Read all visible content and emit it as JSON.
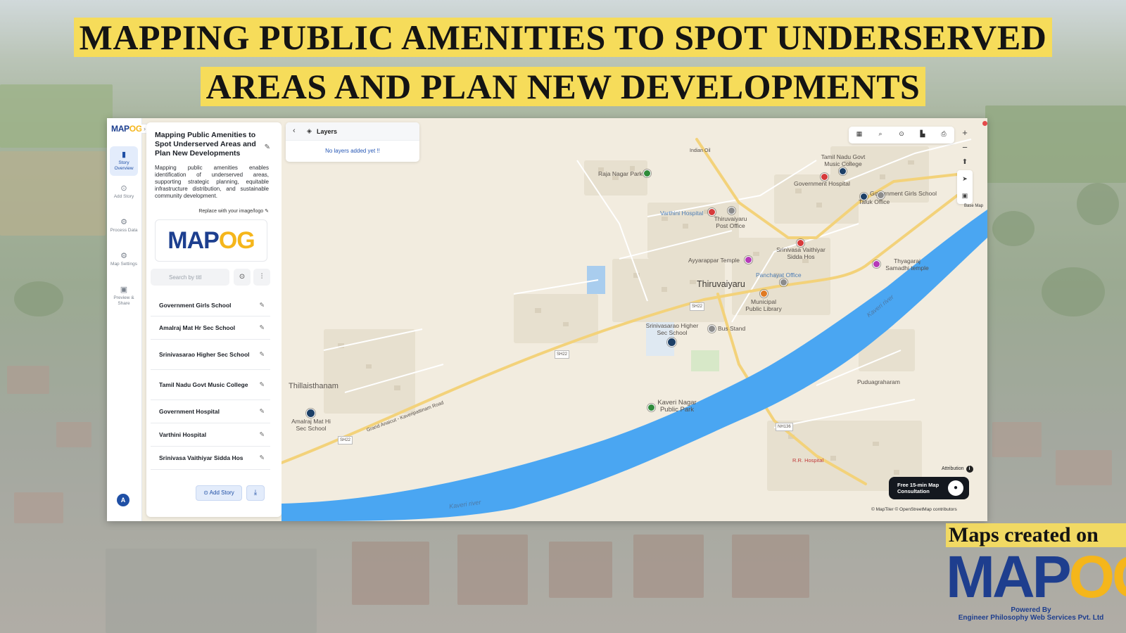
{
  "headline": {
    "line1": "MAPPING PUBLIC AMENITIES TO SPOT UNDERSERVED",
    "line2": "AREAS AND PLAN NEW DEVELOPMENTS"
  },
  "rail": {
    "logo": "MAP",
    "logo_accent": "OG",
    "items": [
      {
        "label": "Story Overview",
        "icon": "book-icon",
        "active": true
      },
      {
        "label": "Add Story",
        "icon": "map-pin-icon",
        "active": false
      },
      {
        "label": "Process Data",
        "icon": "gear-icon",
        "active": false
      },
      {
        "label": "Map Settings",
        "icon": "settings-icon",
        "active": false
      },
      {
        "label": "Preview & Share",
        "icon": "share-icon",
        "active": false
      }
    ],
    "avatar": "A"
  },
  "panel": {
    "title": "Mapping Public Amenities to Spot Underserved Areas and Plan New Developments",
    "description": "Mapping public amenities enables identification of underserved areas, supporting strategic planning, equitable infrastructure distribution, and sustainable community development.",
    "replace_label": "Replace with your image/logo",
    "logo": "MAP",
    "logo_accent": "OG",
    "search_placeholder": "Search by titl",
    "stories": [
      "Government Girls School",
      "Amalraj Mat Hr Sec School",
      "Srinivasarao Higher Sec School",
      "Tamil Nadu Govt Music College",
      "Government Hospital",
      "Varthini Hospital",
      "Srinivasa Vaithiyar Sidda Hos"
    ],
    "add_story_label": "Add Story"
  },
  "layers": {
    "title": "Layers",
    "empty_text": "No layers added yet !!"
  },
  "map": {
    "places": {
      "thiruvaiyaru": "Thiruvaiyaru",
      "thillaisthanam": "Thillaisthanam",
      "puduagraharam": "Puduagraharam",
      "river1": "Kaveri river",
      "river2": "Kaveri river",
      "road": "Grand Anaicut - Kaveripattinam Road",
      "indian_oil": "Indian Oil",
      "rr_hospital": "R.R. Hospital",
      "sh22a": "SH22",
      "sh22b": "SH22",
      "sh22c": "SH22",
      "nh136": "NH136"
    },
    "pois": [
      {
        "label": "Raja Nagar Park",
        "color": "#2e8b3a"
      },
      {
        "label": "Tamil Nadu Govt Music College",
        "color": "#d63a3a"
      },
      {
        "label": "Government Hospital",
        "color": "#d63a3a"
      },
      {
        "label": "Government Girls School",
        "color": "#1c3f66"
      },
      {
        "label": "Taluk Office",
        "color": "#8c8c8c"
      },
      {
        "label": "Varthini Hospital",
        "color": "#d63a3a"
      },
      {
        "label": "Thiruvaiyaru Post Office",
        "color": "#8c8c8c"
      },
      {
        "label": "Srinivasa Vaithiyar Sidda Hos",
        "color": "#d63a3a"
      },
      {
        "label": "Ayyarappar Temple",
        "color": "#b53ab8"
      },
      {
        "label": "Thyagaraj Samadhi temple",
        "color": "#b53ab8"
      },
      {
        "label": "Panchayat Office",
        "color": "#8c8c8c"
      },
      {
        "label": "Municipal Public Library",
        "color": "#e07a22"
      },
      {
        "label": "Bus Stand",
        "color": "#8c8c8c"
      },
      {
        "label": "Srinivasarao Higher Sec School",
        "color": "#1c3f66"
      },
      {
        "label": "Kaveri Nagar Public Park",
        "color": "#2e8b3a"
      },
      {
        "label": "Amalraj Mat Hi Sec School",
        "color": "#1c3f66"
      }
    ],
    "attribution": "Attribution",
    "consult": "Free 15-min Map Consultation",
    "osm_credit": "© MapTiler © OpenStreetMap contributors",
    "basemap": "Base Map"
  },
  "brand": {
    "line": "Maps created on",
    "logo": "MAP",
    "logo_accent": "OG",
    "powered_by": "Powered By",
    "company": "Engineer Philosophy Web Services Pvt. Ltd"
  },
  "colors": {
    "accent": "#1f4fa5",
    "brand_yellow": "#f5b61b",
    "highlight": "#f6dc5a",
    "river": "#4aa6f2",
    "road": "#f3d27a"
  }
}
